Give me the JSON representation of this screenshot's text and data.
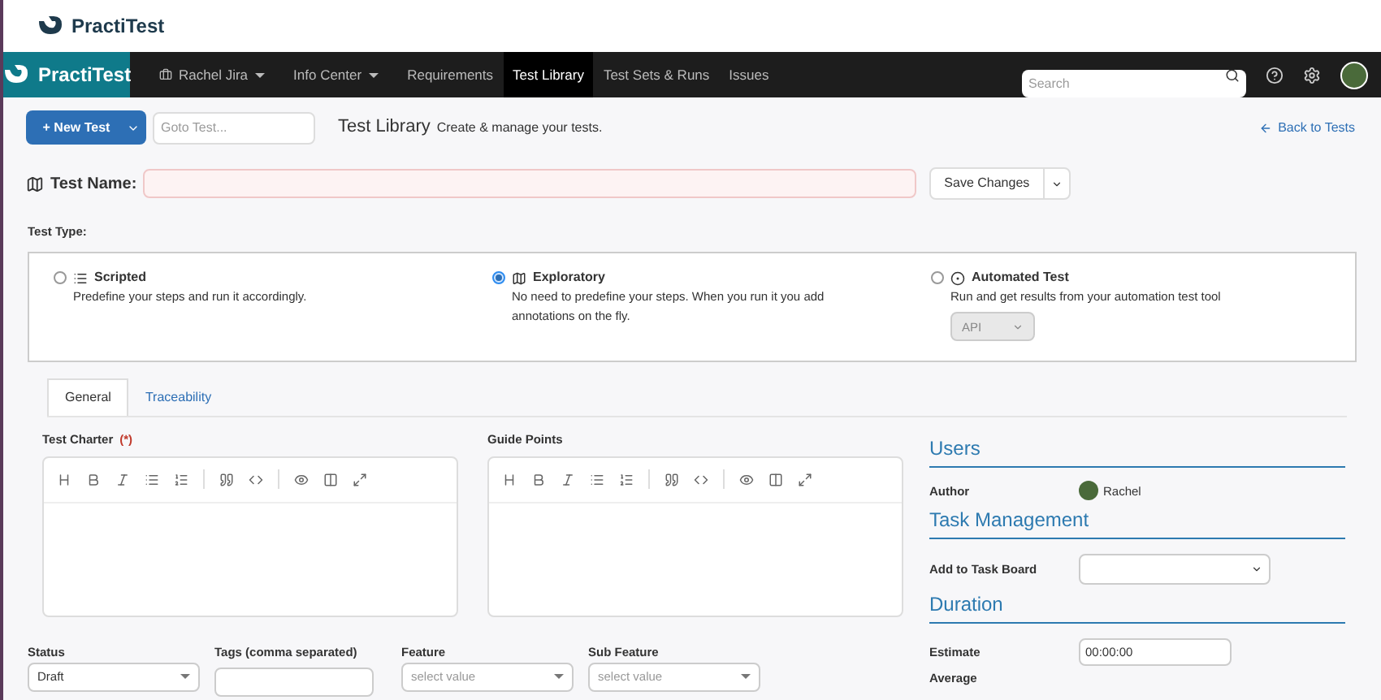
{
  "brand": {
    "header": "PractiTest",
    "nav": "PractiTest"
  },
  "nav": {
    "items": [
      {
        "label": "Rachel Jira",
        "kind": "project",
        "selected": false
      },
      {
        "label": "Info Center",
        "kind": "menu",
        "selected": false
      },
      {
        "label": "Requirements",
        "kind": "link",
        "selected": false
      },
      {
        "label": "Test Library",
        "kind": "link",
        "selected": true
      },
      {
        "label": "Test Sets & Runs",
        "kind": "link",
        "selected": false
      },
      {
        "label": "Issues",
        "kind": "link",
        "selected": false
      }
    ],
    "search": {
      "placeholder": "Search"
    }
  },
  "toolbar": {
    "new_button": "+ New Test",
    "goto": {
      "placeholder": "Goto Test..."
    },
    "title": "Test Library",
    "subtitle": "Create & manage your tests.",
    "back_link": "Back to Tests"
  },
  "test_name": {
    "label": "Test Name:",
    "save_button": "Save Changes"
  },
  "test_type": {
    "label": "Test Type:",
    "options": [
      {
        "name": "Scripted",
        "kind": "list",
        "description": "Predefine your steps and run it accordingly.",
        "selected": false
      },
      {
        "name": "Exploratory",
        "kind": "map",
        "description": "No need to predefine your steps. When you run it you add annotations on the fly.",
        "selected": true
      },
      {
        "name": "Automated Test",
        "kind": "automated",
        "description": "Run and get results from your automation test tool",
        "selected": false,
        "tool": "API"
      }
    ]
  },
  "tabs": [
    {
      "label": "General",
      "selected": true
    },
    {
      "label": "Traceability",
      "selected": false
    }
  ],
  "editors": [
    {
      "label": "Test Charter",
      "required": true
    },
    {
      "label": "Guide Points",
      "required": false
    }
  ],
  "required_mark": "(*)",
  "fields": [
    {
      "label": "Status",
      "kind": "select",
      "value": "Draft"
    },
    {
      "label": "Tags (comma separated)",
      "kind": "text"
    },
    {
      "label": "Feature",
      "kind": "select",
      "placeholder": "select value"
    },
    {
      "label": "Sub Feature",
      "kind": "select",
      "placeholder": "select value"
    }
  ],
  "side": {
    "users_title": "Users",
    "author_label": "Author",
    "author": "Rachel",
    "task_title": "Task Management",
    "task_label": "Add to Task Board",
    "duration_title": "Duration",
    "estimate_label": "Estimate",
    "estimate": "00:00:00",
    "average_label": "Average"
  }
}
